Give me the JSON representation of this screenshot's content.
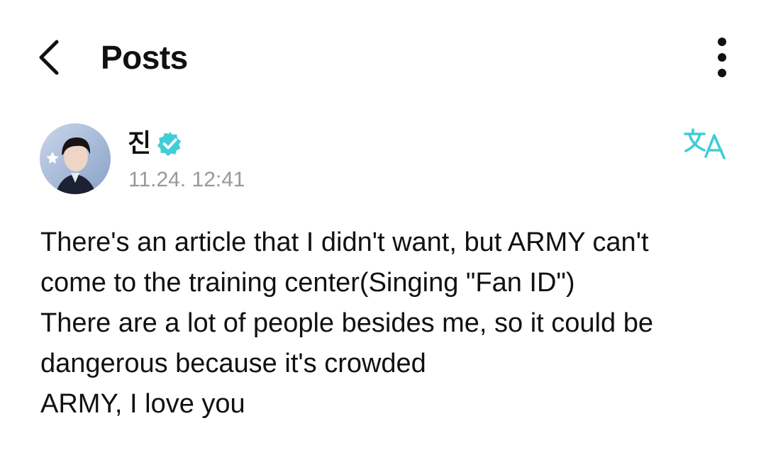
{
  "header": {
    "title": "Posts",
    "back_icon": "chevron-left-icon",
    "more_icon": "more-vertical-icon"
  },
  "post": {
    "author_name": "진",
    "verified_icon": "verified-badge-icon",
    "verified_color": "#3fcdd6",
    "timestamp": "11.24. 12:41",
    "translate_icon": "translate-icon",
    "translate_color": "#3fcdd6",
    "lines": [
      "There's an article that I didn't want, but ARMY can't",
      "come to the training center(Singing \"Fan ID\")",
      "There are a lot of people besides me, so it could be",
      "dangerous because it's crowded",
      "ARMY, I love you"
    ]
  }
}
